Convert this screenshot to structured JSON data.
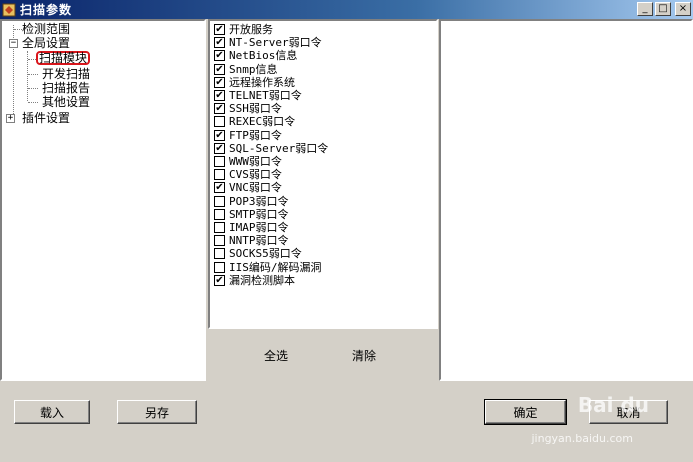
{
  "window": {
    "title": "扫描参数",
    "controls": {
      "minimize": "_",
      "maximize": "□",
      "close": "×"
    }
  },
  "tree": {
    "items": [
      {
        "label": "检测范围",
        "expander": ""
      },
      {
        "label": "全局设置",
        "expander": "−"
      },
      {
        "label": "扫描模块",
        "expander": "",
        "selected": true
      },
      {
        "label": "开发扫描",
        "expander": ""
      },
      {
        "label": "扫描报告",
        "expander": ""
      },
      {
        "label": "其他设置",
        "expander": ""
      },
      {
        "label": "插件设置",
        "expander": "+"
      }
    ]
  },
  "checklist": {
    "items": [
      {
        "label": "开放服务",
        "checked": true
      },
      {
        "label": "NT-Server弱口令",
        "checked": true
      },
      {
        "label": "NetBios信息",
        "checked": true
      },
      {
        "label": "Snmp信息",
        "checked": true
      },
      {
        "label": "远程操作系统",
        "checked": true
      },
      {
        "label": "TELNET弱口令",
        "checked": true
      },
      {
        "label": "SSH弱口令",
        "checked": true
      },
      {
        "label": "REXEC弱口令",
        "checked": false
      },
      {
        "label": "FTP弱口令",
        "checked": true
      },
      {
        "label": "SQL-Server弱口令",
        "checked": true
      },
      {
        "label": "WWW弱口令",
        "checked": false
      },
      {
        "label": "CVS弱口令",
        "checked": false
      },
      {
        "label": "VNC弱口令",
        "checked": true
      },
      {
        "label": "POP3弱口令",
        "checked": false
      },
      {
        "label": "SMTP弱口令",
        "checked": false
      },
      {
        "label": "IMAP弱口令",
        "checked": false
      },
      {
        "label": "NNTP弱口令",
        "checked": false
      },
      {
        "label": "SOCKS5弱口令",
        "checked": false
      },
      {
        "label": "IIS编码/解码漏洞",
        "checked": false
      },
      {
        "label": "漏洞检测脚本",
        "checked": true
      }
    ],
    "select_all_label": "全选",
    "clear_label": "清除"
  },
  "buttons": {
    "load": "载入",
    "save_as": "另存",
    "ok": "确定",
    "cancel": "取消"
  },
  "watermark": {
    "text": "Bai du",
    "sub": "jingyan.baidu.com"
  }
}
